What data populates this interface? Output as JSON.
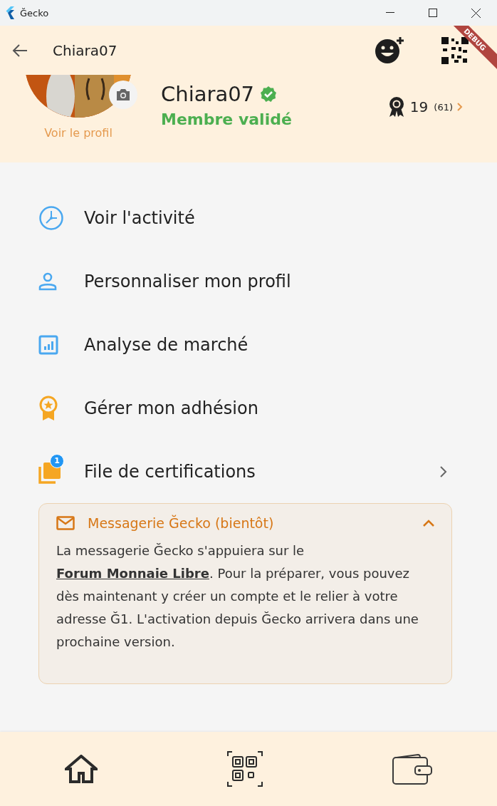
{
  "window": {
    "title": "Ğecko"
  },
  "app_bar": {
    "title": "Chiara07",
    "debug_banner": "DEBUG"
  },
  "profile": {
    "name": "Chiara07",
    "verified": true,
    "status": "Membre validé",
    "view_profile": "Voir le profil",
    "certifications": "19",
    "pending_certifications": "(61)"
  },
  "menu": [
    {
      "kind": "clock",
      "label": "Voir l'activité"
    },
    {
      "kind": "person",
      "label": "Personnaliser mon profil"
    },
    {
      "kind": "chart",
      "label": "Analyse de marché"
    },
    {
      "kind": "award",
      "label": "Gérer mon adhésion"
    },
    {
      "kind": "queue",
      "label": "File de certifications",
      "badge": "1",
      "has_arrow": true
    }
  ],
  "messaging_card": {
    "title": "Messagerie Ğecko (bientôt)",
    "expanded": true,
    "text_before": "La messagerie Ğecko s'appuiera sur le ",
    "link": "Forum Monnaie Libre",
    "text_after": ". Pour la préparer, vous pouvez dès maintenant y créer un compte et le relier à votre adresse Ğ1. L'activation depuis Ğecko arrivera dans une prochaine version."
  },
  "bottom_nav": [
    {
      "kind": "home"
    },
    {
      "kind": "scan"
    },
    {
      "kind": "wallet"
    }
  ]
}
